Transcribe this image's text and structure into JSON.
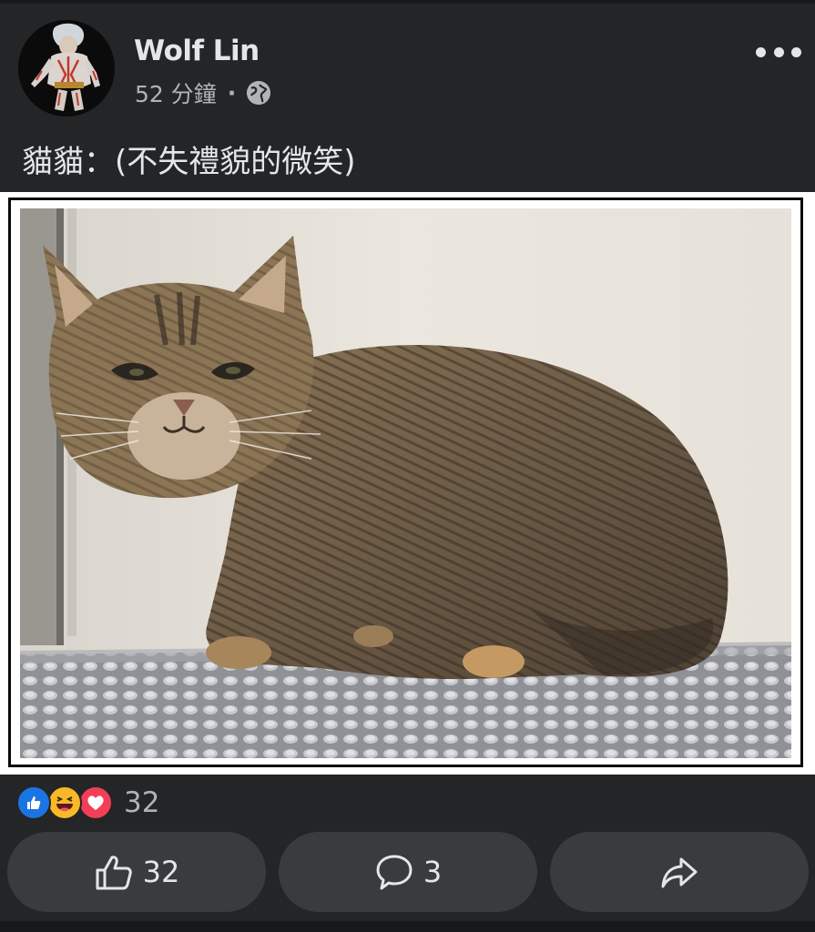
{
  "post": {
    "author": "Wolf Lin",
    "time": "52 分鐘",
    "separator": "·",
    "privacy_icon": "globe-icon",
    "menu_icon": "more-dots-icon",
    "caption": "貓貓：(不失禮貌的微笑)"
  },
  "reactions": {
    "icons": [
      "like-reaction-icon",
      "haha-reaction-icon",
      "love-reaction-icon"
    ],
    "count": "32"
  },
  "actions": {
    "like_count": "32",
    "comment_count": "3",
    "share_icon": "share-arrow-icon"
  },
  "colors": {
    "background": "#242526",
    "button": "#3a3b3c",
    "text": "#e4e6eb",
    "muted": "#b0b3b8",
    "like_blue": "#1b74e4",
    "haha_yellow": "#f7b928",
    "love_red": "#f33e58"
  }
}
